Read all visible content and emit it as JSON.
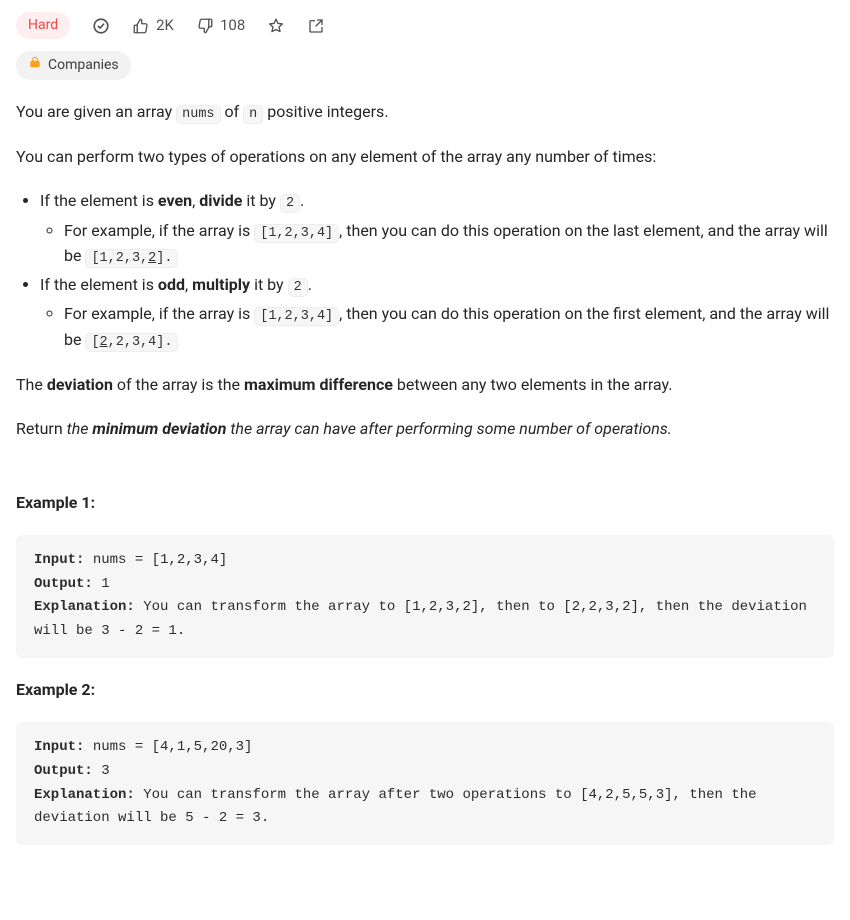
{
  "header": {
    "difficulty": "Hard",
    "likes": "2K",
    "dislikes": "108"
  },
  "companies_pill": "Companies",
  "description": {
    "intro_pre": "You are given an array ",
    "intro_code1": "nums",
    "intro_mid": " of ",
    "intro_code2": "n",
    "intro_post": " positive integers.",
    "ops_intro": "You can perform two types of operations on any element of the array any number of times:",
    "even_pre": "If the element is ",
    "even_b1": "even",
    "even_sep": ", ",
    "even_b2": "divide",
    "even_post1": " it by ",
    "even_code": "2",
    "even_post2": ".",
    "even_ex_pre": "For example, if the array is ",
    "even_ex_code1": "[1,2,3,4]",
    "even_ex_mid": ", then you can do this operation on the last element, and the array will be ",
    "even_ex_code2_pre": "[1,2,3,",
    "even_ex_code2_u": "2",
    "even_ex_code2_post": "].",
    "odd_pre": "If the element is ",
    "odd_b1": "odd",
    "odd_sep": ", ",
    "odd_b2": "multiply",
    "odd_post1": " it by ",
    "odd_code": "2",
    "odd_post2": ".",
    "odd_ex_pre": "For example, if the array is ",
    "odd_ex_code1": "[1,2,3,4]",
    "odd_ex_mid": ", then you can do this operation on the first element, and the array will be ",
    "odd_ex_code2_pre": "[",
    "odd_ex_code2_u": "2",
    "odd_ex_code2_post": ",2,3,4].",
    "dev_pre": "The ",
    "dev_b1": "deviation",
    "dev_mid": " of the array is the ",
    "dev_b2": "maximum difference",
    "dev_post": " between any two elements in the array.",
    "ret_pre": "Return ",
    "ret_i_pre": "the ",
    "ret_bi": "minimum deviation",
    "ret_i_post": " the array can have after performing some number of operations."
  },
  "examples": [
    {
      "label": "Example 1:",
      "input_k": "Input:",
      "input_v": " nums = [1,2,3,4]",
      "output_k": "Output:",
      "output_v": " 1",
      "expl_k": "Explanation:",
      "expl_v": " You can transform the array to [1,2,3,2], then to [2,2,3,2], then the deviation will be 3 - 2 = 1."
    },
    {
      "label": "Example 2:",
      "input_k": "Input:",
      "input_v": " nums = [4,1,5,20,3]",
      "output_k": "Output:",
      "output_v": " 3",
      "expl_k": "Explanation:",
      "expl_v": " You can transform the array after two operations to [4,2,5,5,3], then the deviation will be 5 - 2 = 3."
    }
  ]
}
